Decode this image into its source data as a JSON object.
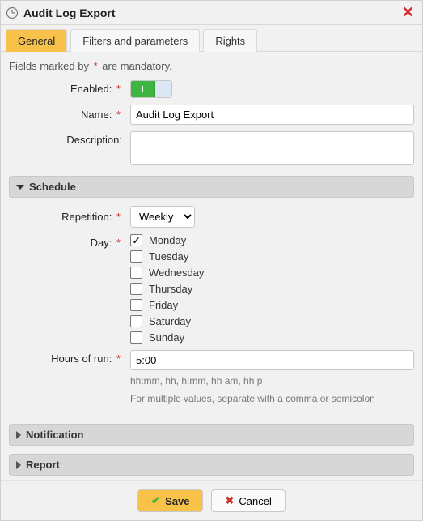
{
  "dialog": {
    "title": "Audit Log Export"
  },
  "tabs": {
    "general": "General",
    "filters": "Filters and parameters",
    "rights": "Rights",
    "active": "general"
  },
  "mandatory_prefix": "Fields marked by",
  "mandatory_suffix": "are mandatory.",
  "fields": {
    "enabled_label": "Enabled:",
    "enabled_on_text": "I",
    "name_label": "Name:",
    "name_value": "Audit Log Export",
    "description_label": "Description:",
    "description_value": ""
  },
  "schedule": {
    "header": "Schedule",
    "expanded": true,
    "repetition_label": "Repetition:",
    "repetition_value": "Weekly",
    "day_label": "Day:",
    "days": [
      {
        "label": "Monday",
        "checked": true
      },
      {
        "label": "Tuesday",
        "checked": false
      },
      {
        "label": "Wednesday",
        "checked": false
      },
      {
        "label": "Thursday",
        "checked": false
      },
      {
        "label": "Friday",
        "checked": false
      },
      {
        "label": "Saturday",
        "checked": false
      },
      {
        "label": "Sunday",
        "checked": false
      }
    ],
    "hours_label": "Hours of run:",
    "hours_value": "5:00",
    "hours_hint1": "hh:mm, hh, h:mm, hh am, hh p",
    "hours_hint2": "For multiple values, separate with a comma or semicolon"
  },
  "notification": {
    "header": "Notification",
    "expanded": false
  },
  "report": {
    "header": "Report",
    "expanded": false
  },
  "buttons": {
    "save": "Save",
    "cancel": "Cancel"
  }
}
